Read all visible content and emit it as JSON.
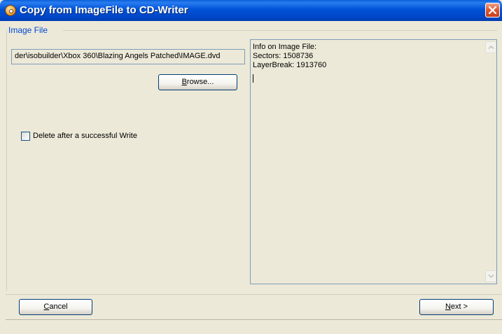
{
  "window": {
    "title": "Copy from ImageFile to CD-Writer",
    "icon": "disc-app-icon",
    "close_icon": "close-icon"
  },
  "group": {
    "label": "Image File"
  },
  "image_path": {
    "value": "der\\isobuilder\\Xbox 360\\Blazing Angels Patched\\IMAGE.dvd"
  },
  "browse_button": {
    "mnemonic": "B",
    "rest": "rowse..."
  },
  "delete_checkbox": {
    "label": "Delete after a successful Write",
    "checked": false
  },
  "info": {
    "lines": [
      "Info on Image File:",
      "Sectors: 1508736",
      "LayerBreak: 1913760"
    ]
  },
  "cancel_button": {
    "mnemonic": "C",
    "rest": "ancel"
  },
  "next_button": {
    "mnemonic": "N",
    "rest": "ext >"
  },
  "colors": {
    "titlebar": "#0052d6",
    "dialog_bg": "#ece9d8",
    "group_label": "#0046d5",
    "close_button": "#e0552f"
  }
}
